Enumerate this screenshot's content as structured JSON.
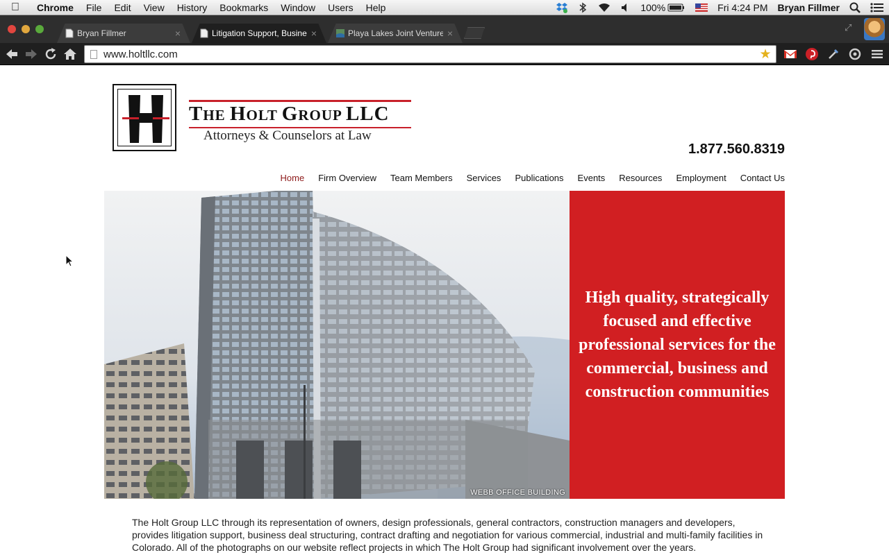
{
  "menubar": {
    "app_name": "Chrome",
    "items": [
      "File",
      "Edit",
      "View",
      "History",
      "Bookmarks",
      "Window",
      "Users",
      "Help"
    ],
    "battery": "100%",
    "clock": "Fri 4:24 PM",
    "user": "Bryan Fillmer"
  },
  "tabs": [
    {
      "title": "Bryan Fillmer",
      "active": false
    },
    {
      "title": "Litigation Support, Business",
      "active": true
    },
    {
      "title": "Playa Lakes Joint Venture",
      "active": false
    }
  ],
  "omnibox": {
    "url": "www.holtllc.com"
  },
  "site": {
    "logo_name_first": "T",
    "logo_name_rest": "HE ",
    "logo_name_holt_first": "H",
    "logo_name_holt_rest": "OLT ",
    "logo_name_group_first": "G",
    "logo_name_group_rest": "ROUP ",
    "logo_name_llc": "LLC",
    "logo_sub": "Attorneys & Counselors at Law",
    "phone": "1.877.560.8319",
    "nav": [
      "Home",
      "Firm Overview",
      "Team Members",
      "Services",
      "Publications",
      "Events",
      "Resources",
      "Employment",
      "Contact Us"
    ],
    "nav_current": "Home",
    "hero_caption": "WEBB OFFICE BUILDING",
    "tagline": "High quality, strategically focused and effective professional services for the commercial, business and construction communities",
    "intro": "The Holt Group LLC through its representation of owners, design professionals, general contractors, construction managers and developers, provides litigation support, business deal structuring, contract drafting and negotiation for various commercial, industrial and multi-family facilities in Colorado. All of the photographs on our website reflect projects in which The Holt Group had significant involvement over the years."
  },
  "colors": {
    "brand_red": "#d11f22",
    "nav_current": "#8d1a1a"
  },
  "icons": [
    "apple-icon",
    "dropbox-icon",
    "bluetooth-icon",
    "wifi-icon",
    "volume-icon",
    "battery-icon",
    "flag-icon",
    "spotlight-icon",
    "notification-list-icon",
    "back-icon",
    "forward-icon",
    "reload-icon",
    "home-icon",
    "star-icon",
    "gmail-icon",
    "pinterest-icon",
    "eyedropper-icon",
    "extension-icon",
    "chrome-menu-icon"
  ]
}
